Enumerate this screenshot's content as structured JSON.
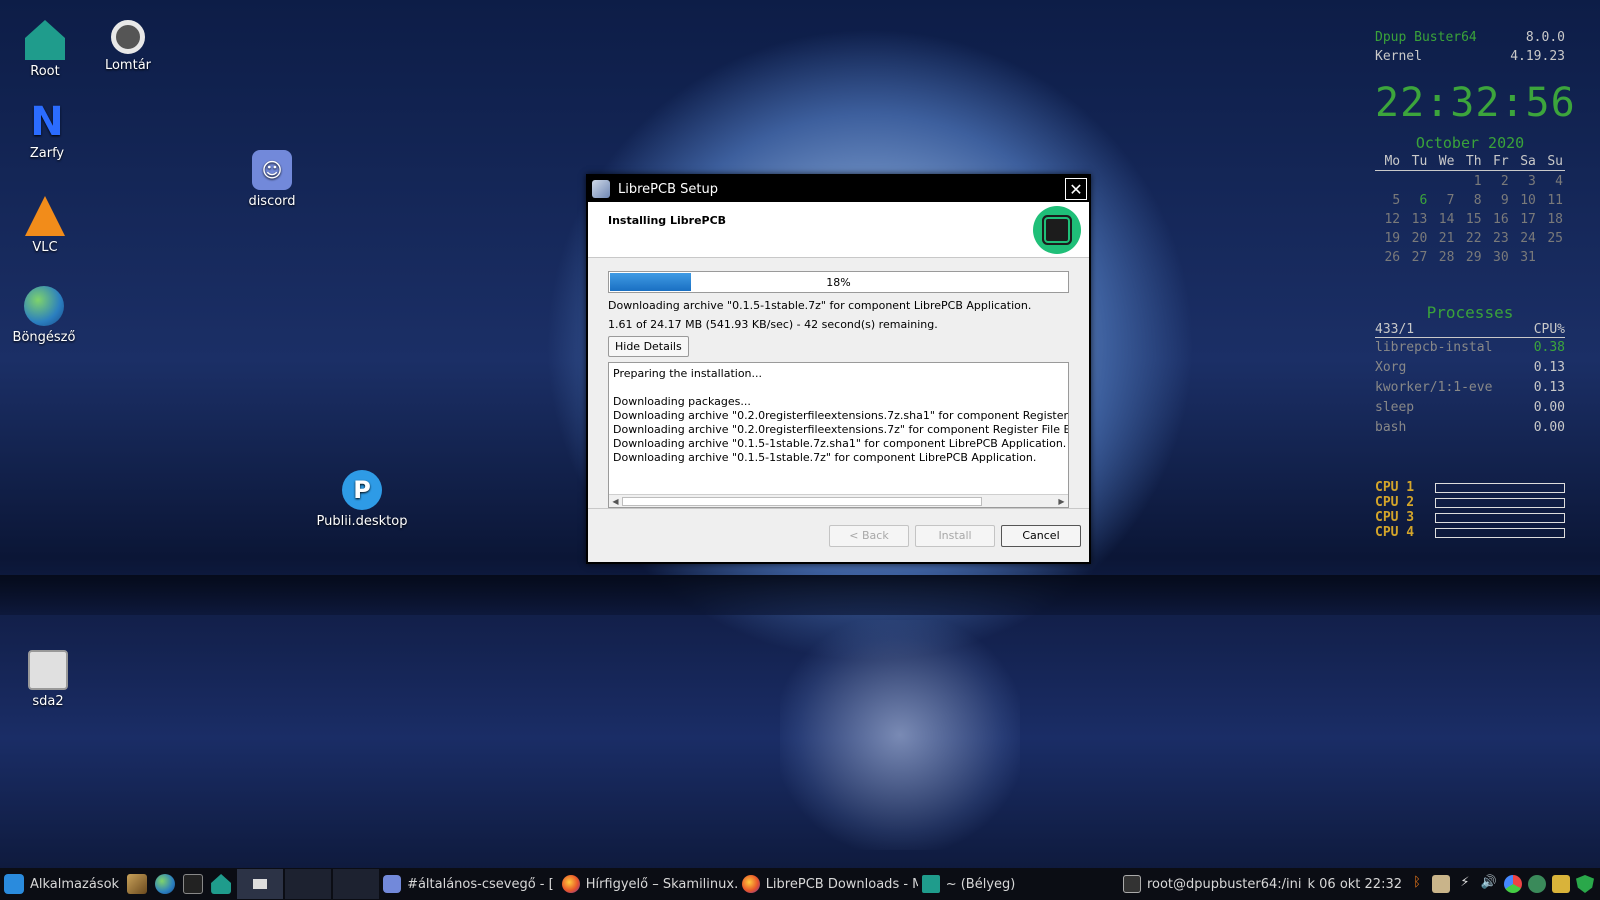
{
  "desktop": {
    "icons": {
      "root": "Root",
      "trash": "Lomtár",
      "zarfy": "Zarfy",
      "discord": "discord",
      "vlc": "VLC",
      "browser": "Böngésző",
      "publii": "Publii.desktop",
      "drive": "sda2"
    }
  },
  "conky": {
    "distro_label": "Dpup Buster64",
    "distro_value": "8.0.0",
    "kernel_label": "Kernel",
    "kernel_value": "4.19.23",
    "clock": "22:32:56",
    "calendar_title": "October  2020",
    "weekdays": [
      "Mo",
      "Tu",
      "We",
      "Th",
      "Fr",
      "Sa",
      "Su"
    ],
    "processes_title": "Processes",
    "proc_count": "433/1",
    "proc_cpu_header": "CPU%",
    "processes": [
      {
        "name": "librepcb-instal",
        "cpu": "0.38"
      },
      {
        "name": "Xorg",
        "cpu": "0.13"
      },
      {
        "name": "kworker/1:1-eve",
        "cpu": "0.13"
      },
      {
        "name": "sleep",
        "cpu": "0.00"
      },
      {
        "name": "bash",
        "cpu": "0.00"
      }
    ],
    "cpus": [
      "CPU 1",
      "CPU 2",
      "CPU 3",
      "CPU 4"
    ]
  },
  "dialog": {
    "title": "LibrePCB Setup",
    "heading": "Installing LibrePCB",
    "progress_percent": 18,
    "progress_label": "18%",
    "status_line": "Downloading archive \"0.1.5-1stable.7z\" for component LibrePCB Application.",
    "rate_line": "1.61 of 24.17 MB (541.93 KB/sec) - 42 second(s) remaining.",
    "hide_details": "Hide Details",
    "log": {
      "line1": "Preparing the installation...",
      "line2": "Downloading packages...",
      "line3": "Downloading archive \"0.2.0registerfileextensions.7z.sha1\" for component Register File Extensions.",
      "line4": "Downloading archive \"0.2.0registerfileextensions.7z\" for component Register File Extensions.",
      "line5": "Downloading archive \"0.1.5-1stable.7z.sha1\" for component LibrePCB Application.",
      "line6": "Downloading archive \"0.1.5-1stable.7z\" for component LibrePCB Application."
    },
    "back": "< Back",
    "install": "Install",
    "cancel": "Cancel"
  },
  "taskbar": {
    "start_label": "Alkalmazások",
    "tasks": {
      "discord": "#általános-csevegő - [",
      "firefox1": "Hírfigyelő – Skamilinux.h",
      "firefox2": "LibrePCB Downloads - M",
      "files": "~ (Bélyeg)"
    },
    "terminal_title": "root@dpupbuster64:/ini",
    "datetime": "k 06 okt 22:32"
  },
  "colors": {
    "conky_green": "#3aa33a",
    "progress_blue": "#1a6fc2",
    "taskbar_bg": "#0b0d14"
  }
}
